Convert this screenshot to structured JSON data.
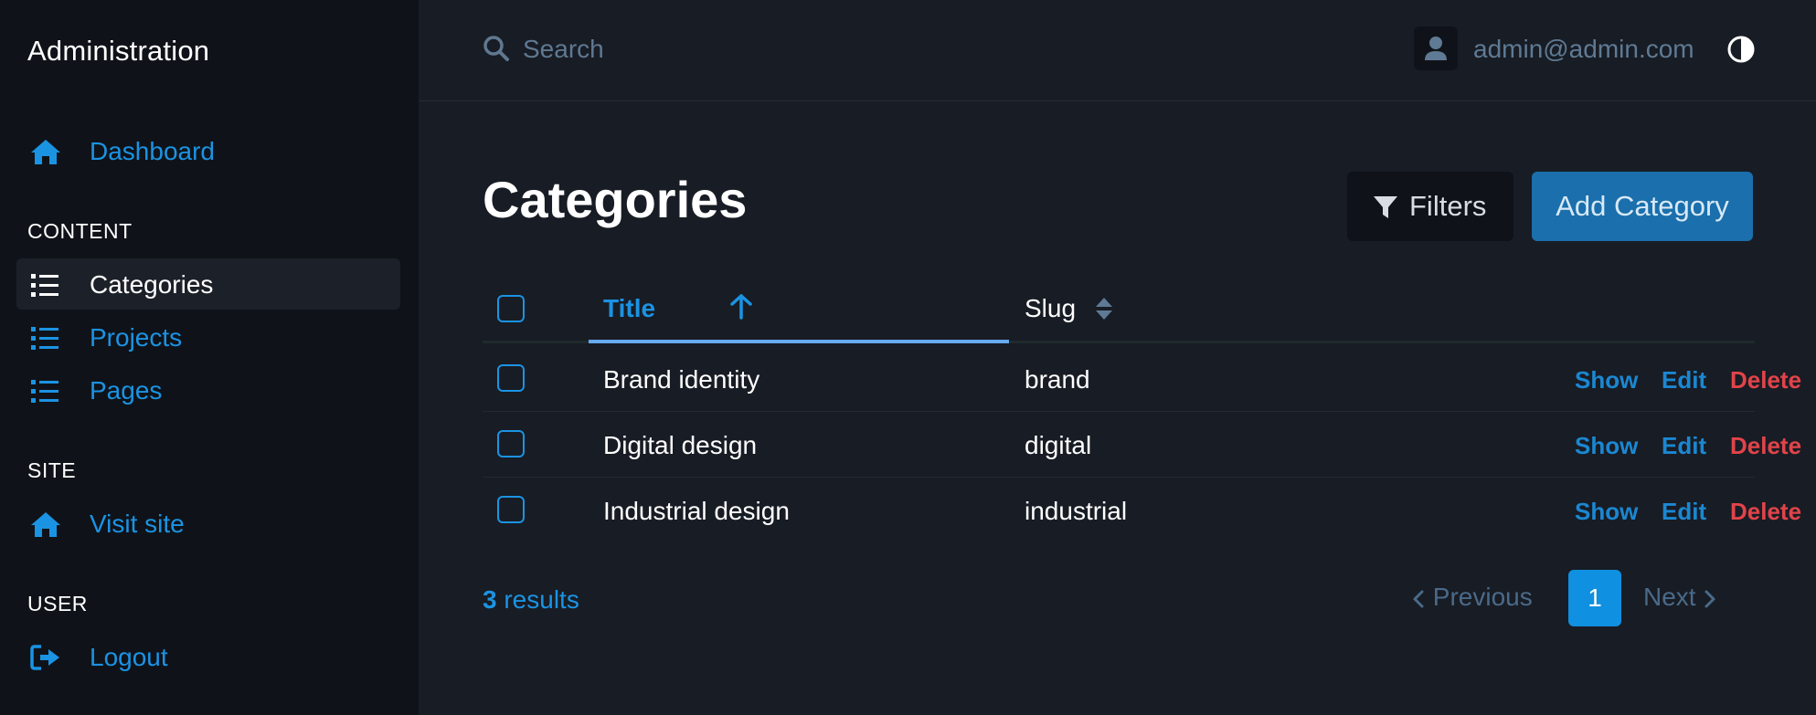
{
  "sidebar": {
    "brand": "Administration",
    "dashboard": {
      "label": "Dashboard",
      "icon": "home-icon"
    },
    "sections": [
      {
        "label": "CONTENT",
        "items": [
          {
            "label": "Categories",
            "icon": "list-icon",
            "active": true
          },
          {
            "label": "Projects",
            "icon": "list-icon"
          },
          {
            "label": "Pages",
            "icon": "list-icon"
          }
        ]
      },
      {
        "label": "SITE",
        "items": [
          {
            "label": "Visit site",
            "icon": "home-icon"
          }
        ]
      },
      {
        "label": "USER",
        "items": [
          {
            "label": "Logout",
            "icon": "logout-icon"
          }
        ]
      }
    ]
  },
  "header": {
    "search_placeholder": "Search",
    "user_email": "admin@admin.com",
    "theme_icon": "contrast-icon"
  },
  "page": {
    "title": "Categories",
    "filters_label": "Filters",
    "add_label": "Add Category"
  },
  "table": {
    "columns": {
      "title": "Title",
      "slug": "Slug"
    },
    "rows": [
      {
        "title": "Brand identity",
        "slug": "brand"
      },
      {
        "title": "Digital design",
        "slug": "digital"
      },
      {
        "title": "Industrial design",
        "slug": "industrial"
      }
    ],
    "actions": {
      "show": "Show",
      "edit": "Edit",
      "delete": "Delete"
    }
  },
  "footer": {
    "results_count": "3",
    "results_label": "results",
    "prev_label": "Previous",
    "next_label": "Next",
    "current_page": "1"
  },
  "colors": {
    "accent": "#1b93e3",
    "danger": "#e0444a",
    "background": "#181c24",
    "sidebar": "#0f1319"
  }
}
